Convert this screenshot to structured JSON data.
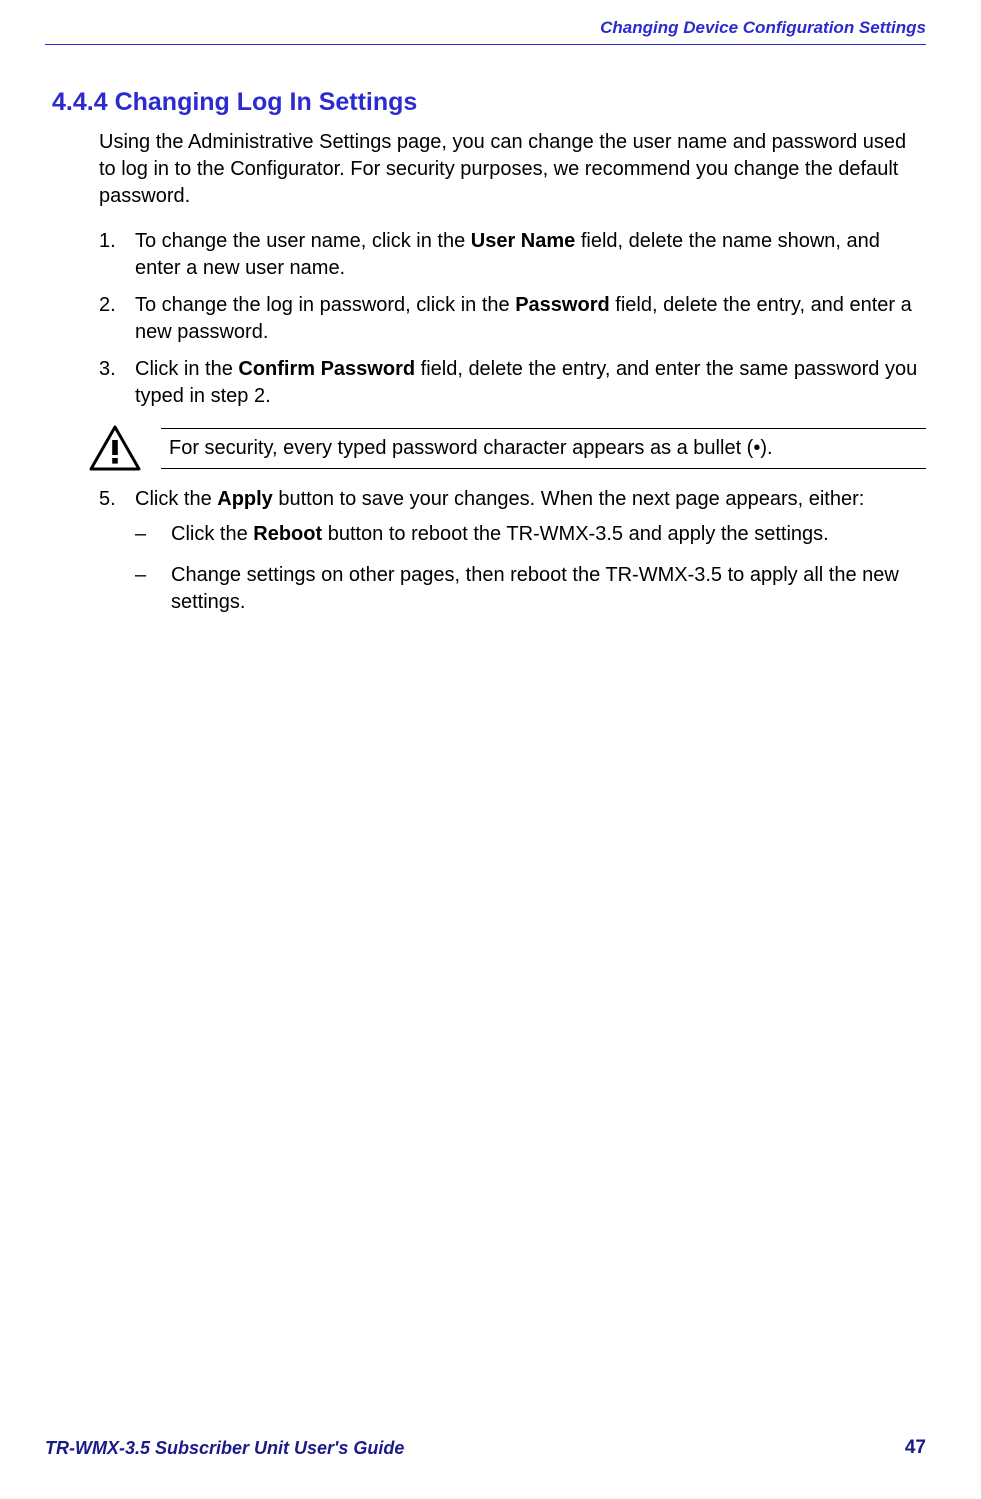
{
  "header": {
    "running_title": "Changing Device Configuration Settings"
  },
  "section": {
    "number": "4.4.4",
    "title": "Changing Log In Settings"
  },
  "intro": "Using the Administrative Settings page, you can change the user name and password used to log in to the Configurator. For security purposes, we recommend you change the default password.",
  "steps": {
    "item1": {
      "num": "1.",
      "pre": "To change the user name, click in the ",
      "bold1": "User Name",
      "post": " field, delete the name shown, and enter a new user name."
    },
    "item2": {
      "num": "2.",
      "pre": "To change the log in password, click in the ",
      "bold1": "Password",
      "post": " field, delete the entry, and enter a new password."
    },
    "item3": {
      "num": "3.",
      "pre": "Click in the ",
      "bold1": "Confirm Password",
      "post": " field, delete the entry, and enter the same password you typed in step 2."
    },
    "item5": {
      "num": "5.",
      "pre": "Click the ",
      "bold1": "Apply",
      "post": " button to save your changes. When the next page appears, either:",
      "sub1": {
        "dash": "–",
        "pre": "Click the ",
        "bold1": "Reboot",
        "post": " button to reboot the TR-WMX-3.5 and apply the settings."
      },
      "sub2": {
        "dash": "–",
        "text": "Change settings on other pages, then reboot the TR-WMX-3.5 to apply all the new settings."
      }
    }
  },
  "note": {
    "text": "For security, every typed password character appears as a bullet (•)."
  },
  "footer": {
    "left": "TR-WMX-3.5 Subscriber Unit User's Guide",
    "page_number": "47"
  }
}
